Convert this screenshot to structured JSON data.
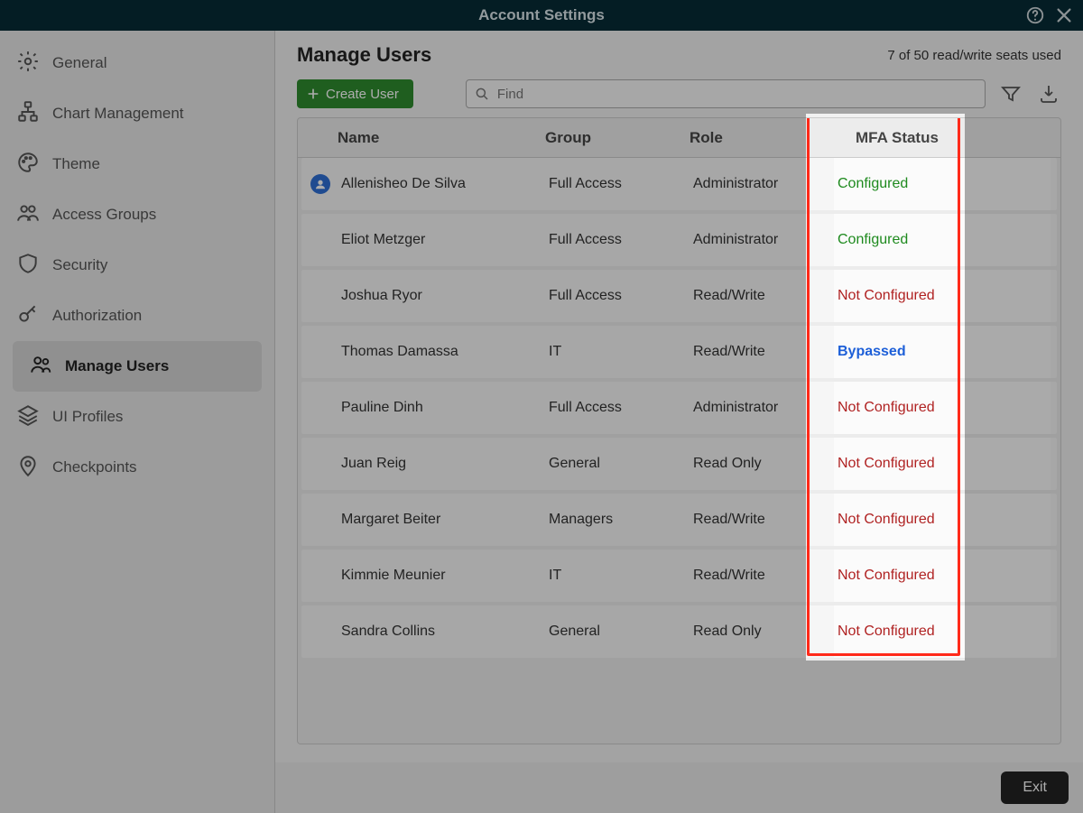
{
  "titlebar": {
    "title": "Account Settings"
  },
  "sidebar": {
    "items": [
      {
        "label": "General",
        "icon": "gear"
      },
      {
        "label": "Chart Management",
        "icon": "hierarchy"
      },
      {
        "label": "Theme",
        "icon": "palette"
      },
      {
        "label": "Access Groups",
        "icon": "group"
      },
      {
        "label": "Security",
        "icon": "shield"
      },
      {
        "label": "Authorization",
        "icon": "key"
      },
      {
        "label": "Manage Users",
        "icon": "users",
        "active": true
      },
      {
        "label": "UI Profiles",
        "icon": "layers"
      },
      {
        "label": "Checkpoints",
        "icon": "pin"
      }
    ]
  },
  "main": {
    "title": "Manage Users",
    "seats_text": "7 of 50 read/write seats used",
    "create_label": "Create User",
    "search_placeholder": "Find",
    "columns": {
      "name": "Name",
      "group": "Group",
      "role": "Role",
      "mfa": "MFA Status"
    },
    "rows": [
      {
        "name": "Allenisheo De Silva",
        "group": "Full Access",
        "role": "Administrator",
        "mfa": "Configured",
        "has_avatar": true
      },
      {
        "name": "Eliot Metzger",
        "group": "Full Access",
        "role": "Administrator",
        "mfa": "Configured"
      },
      {
        "name": "Joshua Ryor",
        "group": "Full Access",
        "role": "Read/Write",
        "mfa": "Not Configured"
      },
      {
        "name": "Thomas Damassa",
        "group": "IT",
        "role": "Read/Write",
        "mfa": "Bypassed"
      },
      {
        "name": "Pauline Dinh",
        "group": "Full Access",
        "role": "Administrator",
        "mfa": "Not Configured"
      },
      {
        "name": "Juan Reig",
        "group": "General",
        "role": "Read Only",
        "mfa": "Not Configured"
      },
      {
        "name": "Margaret Beiter",
        "group": "Managers",
        "role": "Read/Write",
        "mfa": "Not Configured"
      },
      {
        "name": "Kimmie Meunier",
        "group": "IT",
        "role": "Read/Write",
        "mfa": "Not Configured"
      },
      {
        "name": "Sandra Collins",
        "group": "General",
        "role": "Read Only",
        "mfa": "Not Configured"
      }
    ]
  },
  "footer": {
    "exit_label": "Exit"
  },
  "status_colors": {
    "Configured": "#1e8a1e",
    "Not Configured": "#b02222",
    "Bypassed": "#1d5fd8"
  }
}
